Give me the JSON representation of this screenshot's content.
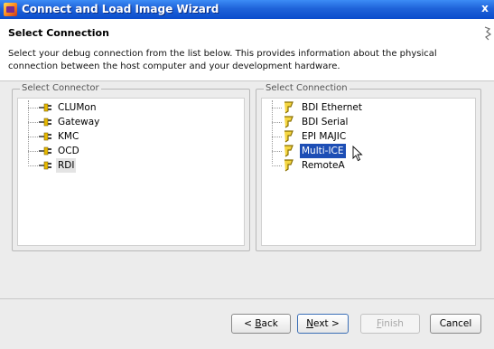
{
  "window": {
    "title": "Connect and Load Image Wizard",
    "close_glyph": "x"
  },
  "header": {
    "section_title": "Select Connection",
    "description": "Select your debug connection from the list below. This provides information about the physical connection between the host computer and your development hardware."
  },
  "connector_group": {
    "legend": "Select Connector",
    "items": [
      {
        "label": "CLUMon",
        "icon": "connector-plug-icon"
      },
      {
        "label": "Gateway",
        "icon": "connector-plug-icon"
      },
      {
        "label": "KMC",
        "icon": "connector-plug-icon"
      },
      {
        "label": "OCD",
        "icon": "connector-plug-icon"
      },
      {
        "label": "RDI",
        "icon": "connector-plug-icon",
        "highlighted": true
      }
    ]
  },
  "connection_group": {
    "legend": "Select Connection",
    "items": [
      {
        "label": "BDI Ethernet",
        "icon": "connection-probe-icon"
      },
      {
        "label": "BDI Serial",
        "icon": "connection-probe-icon"
      },
      {
        "label": "EPI MAJIC",
        "icon": "connection-probe-icon"
      },
      {
        "label": "Multi-ICE",
        "icon": "connection-probe-icon",
        "selected": true
      },
      {
        "label": "RemoteA",
        "icon": "connection-probe-icon"
      }
    ]
  },
  "buttons": {
    "back": {
      "prefix": "< ",
      "mnemonic": "B",
      "rest": "ack"
    },
    "next": {
      "mnemonic": "N",
      "rest": "ext >"
    },
    "finish": {
      "mnemonic": "F",
      "rest": "inish",
      "disabled": true
    },
    "cancel": {
      "label": "Cancel"
    }
  },
  "colors": {
    "titlebar": "#1f63d9",
    "selection": "#1d4eb5",
    "panel_bg": "#ececec"
  }
}
